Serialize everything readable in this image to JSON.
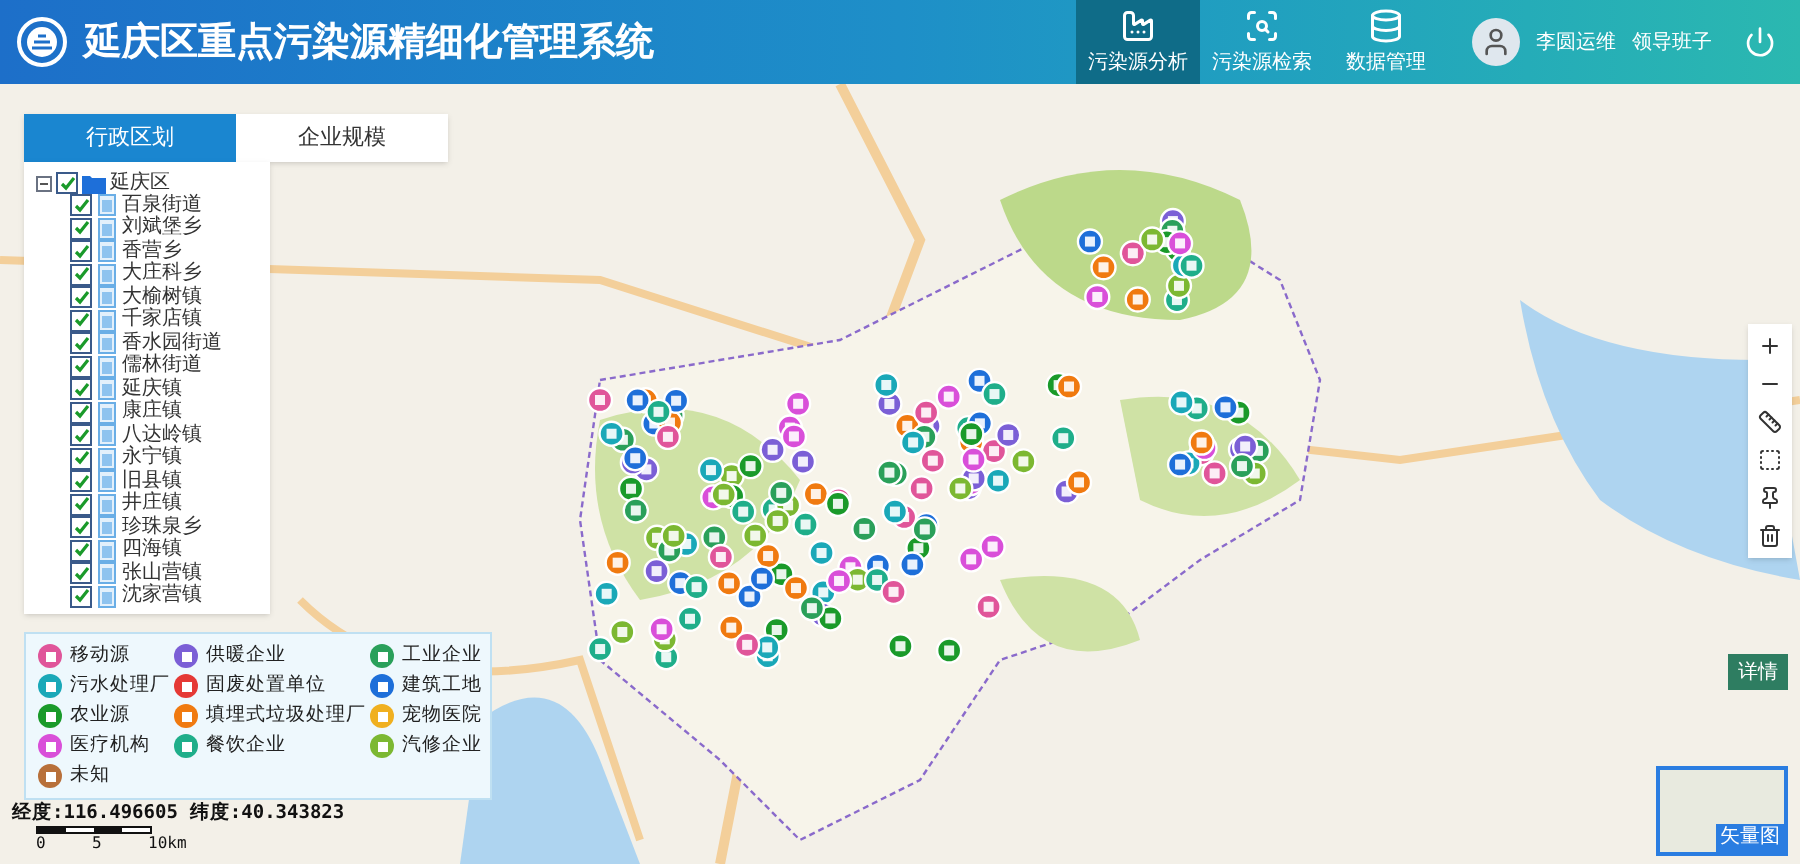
{
  "header": {
    "title": "延庆区重点污染源精细化管理系统",
    "nav": [
      {
        "kind": "analysis",
        "label": "污染源分析",
        "selected": true
      },
      {
        "kind": "search",
        "label": "污染源检索",
        "selected": false
      },
      {
        "kind": "data",
        "label": "数据管理",
        "selected": false
      }
    ],
    "user": {
      "name": "李圆运维",
      "role": "领导班子"
    }
  },
  "tabs": [
    {
      "label": "行政区划",
      "selected": true
    },
    {
      "label": "企业规模",
      "selected": false
    }
  ],
  "tree": [
    {
      "label": "延庆区",
      "checked": true,
      "expanded": true,
      "children": [
        {
          "label": "百泉街道",
          "checked": true
        },
        {
          "label": "刘斌堡乡",
          "checked": true
        },
        {
          "label": "香营乡",
          "checked": true
        },
        {
          "label": "大庄科乡",
          "checked": true
        },
        {
          "label": "大榆树镇",
          "checked": true
        },
        {
          "label": "千家店镇",
          "checked": true
        },
        {
          "label": "香水园街道",
          "checked": true
        },
        {
          "label": "儒林街道",
          "checked": true
        },
        {
          "label": "延庆镇",
          "checked": true
        },
        {
          "label": "康庄镇",
          "checked": true
        },
        {
          "label": "八达岭镇",
          "checked": true
        },
        {
          "label": "永宁镇",
          "checked": true
        },
        {
          "label": "旧县镇",
          "checked": true
        },
        {
          "label": "井庄镇",
          "checked": true
        },
        {
          "label": "珍珠泉乡",
          "checked": true
        },
        {
          "label": "四海镇",
          "checked": true
        },
        {
          "label": "张山营镇",
          "checked": true
        },
        {
          "label": "沈家营镇",
          "checked": true
        }
      ]
    }
  ],
  "legend": [
    {
      "label": "移动源",
      "color": "#e0559a"
    },
    {
      "label": "供暖企业",
      "color": "#7b5fd6"
    },
    {
      "label": "工业企业",
      "color": "#2aa05a"
    },
    {
      "label": "污水处理厂",
      "color": "#1aa8b8"
    },
    {
      "label": "固废处置单位",
      "color": "#e53935"
    },
    {
      "label": "建筑工地",
      "color": "#1e6fd9"
    },
    {
      "label": "农业源",
      "color": "#1a9a2a"
    },
    {
      "label": "填埋式垃圾处理厂",
      "color": "#f07a10"
    },
    {
      "label": "宠物医院",
      "color": "#f0b020"
    },
    {
      "label": "医疗机构",
      "color": "#d94fd9"
    },
    {
      "label": "餐饮企业",
      "color": "#1fae8a"
    },
    {
      "label": "汽修企业",
      "color": "#7cb832"
    },
    {
      "label": "未知",
      "color": "#b8703a"
    }
  ],
  "coordinates": {
    "longitude": "经度:116.496605",
    "latitude": "纬度:40.343823"
  },
  "scale": [
    "0",
    "5",
    "10km"
  ],
  "detail_button": "详情",
  "minimap": {
    "label": "矢量图"
  }
}
